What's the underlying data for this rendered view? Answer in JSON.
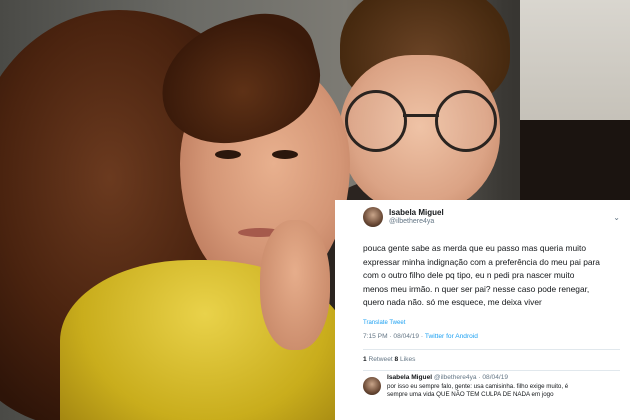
{
  "tweet": {
    "display_name": "Isabela Miguel",
    "handle": "@ilbethere4ya",
    "chevron_icon": "chevron-down-icon",
    "text": "pouca gente sabe as merda que eu passo mas queria muito\nexpressar minha indignação com a preferência do meu pai para\ncom o outro filho dele pq tipo, eu n pedi pra nascer muito\nmenos meu irmão. n quer ser pai? nesse caso pode renegar,\nquero nada não. só me esquece, me deixa viver",
    "translate_label": "Translate Tweet",
    "time": "7:15 PM · 08/04/19 · ",
    "source": "Twitter for Android",
    "retweets_count": "1",
    "retweets_label": " Retweet  ",
    "likes_count": "8",
    "likes_label": " Likes"
  },
  "reply": {
    "display_name": "Isabela Miguel",
    "meta": " @ilbethere4ya · 08/04/19",
    "text": "por isso eu sempre falo, gente: usa camisinha. filho exige muito, é\nsempre uma vida QUE NÃO TEM CULPA DE NADA em jogo"
  }
}
